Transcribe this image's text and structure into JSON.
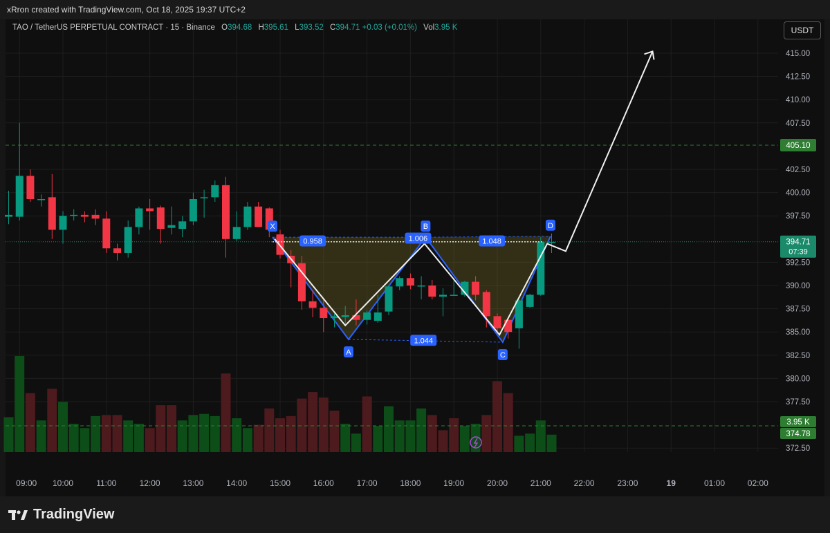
{
  "header": {
    "credit": "xRron created with TradingView.com, Oct 18, 2025 19:37 UTC+2"
  },
  "legend": {
    "symbol": "TAO / TetherUS PERPETUAL CONTRACT · 15 · Binance",
    "open_label": "O",
    "open": "394.68",
    "high_label": "H",
    "high": "395.61",
    "low_label": "L",
    "low": "393.52",
    "close_label": "C",
    "close": "394.71",
    "change": "+0.03 (+0.01%)",
    "vol_label": "Vol",
    "vol": "3.95 K"
  },
  "currency_button": "USDT",
  "brand": {
    "name": "TradingView"
  },
  "colors": {
    "up": "#089981",
    "down": "#f23645",
    "vol_up": "#0c4d18",
    "vol_down": "#4d1a1e",
    "pattern_line": "#2962ff",
    "background": "#0f0f0f"
  },
  "chart_data": {
    "type": "candlestick",
    "timeframe": "15",
    "ylim": [
      371.5,
      417.5
    ],
    "y_ticks": [
      "415.00",
      "412.50",
      "410.00",
      "407.50",
      "402.50",
      "400.00",
      "397.50",
      "392.50",
      "390.00",
      "387.50",
      "385.00",
      "382.50",
      "380.00",
      "377.50",
      "372.50"
    ],
    "x_ticks": [
      "09:00",
      "10:00",
      "11:00",
      "12:00",
      "13:00",
      "14:00",
      "15:00",
      "16:00",
      "17:00",
      "18:00",
      "19:00",
      "20:00",
      "21:00",
      "22:00",
      "23:00",
      "19",
      "01:00",
      "02:00"
    ],
    "candles": [
      {
        "o": 397.4,
        "h": 400.2,
        "l": 396.6,
        "c": 397.6
      },
      {
        "o": 397.4,
        "h": 407.5,
        "l": 397.0,
        "c": 401.8
      },
      {
        "o": 401.8,
        "h": 402.5,
        "l": 399.0,
        "c": 399.3
      },
      {
        "o": 399.3,
        "h": 399.8,
        "l": 398.5,
        "c": 399.3
      },
      {
        "o": 399.5,
        "h": 402.0,
        "l": 395.0,
        "c": 396.0
      },
      {
        "o": 396.0,
        "h": 398.0,
        "l": 394.5,
        "c": 397.5
      },
      {
        "o": 397.5,
        "h": 398.2,
        "l": 397.0,
        "c": 397.6
      },
      {
        "o": 397.6,
        "h": 398.0,
        "l": 396.8,
        "c": 397.4
      },
      {
        "o": 397.6,
        "h": 398.2,
        "l": 396.5,
        "c": 397.2
      },
      {
        "o": 397.2,
        "h": 398.0,
        "l": 393.5,
        "c": 394.0
      },
      {
        "o": 394.0,
        "h": 394.5,
        "l": 392.7,
        "c": 393.5
      },
      {
        "o": 393.5,
        "h": 397.0,
        "l": 393.0,
        "c": 396.3
      },
      {
        "o": 396.3,
        "h": 398.5,
        "l": 395.5,
        "c": 398.3
      },
      {
        "o": 398.3,
        "h": 399.3,
        "l": 396.0,
        "c": 398.0
      },
      {
        "o": 398.4,
        "h": 398.6,
        "l": 394.5,
        "c": 396.1
      },
      {
        "o": 396.2,
        "h": 398.5,
        "l": 395.5,
        "c": 396.5
      },
      {
        "o": 396.1,
        "h": 397.5,
        "l": 395.2,
        "c": 396.9
      },
      {
        "o": 396.9,
        "h": 400.0,
        "l": 396.5,
        "c": 399.3
      },
      {
        "o": 399.4,
        "h": 400.3,
        "l": 397.3,
        "c": 399.5
      },
      {
        "o": 399.5,
        "h": 401.3,
        "l": 399.0,
        "c": 400.8
      },
      {
        "o": 400.8,
        "h": 401.7,
        "l": 393.0,
        "c": 395.0
      },
      {
        "o": 395.0,
        "h": 398.0,
        "l": 394.8,
        "c": 396.3
      },
      {
        "o": 396.3,
        "h": 399.0,
        "l": 396.0,
        "c": 398.5
      },
      {
        "o": 398.5,
        "h": 399.0,
        "l": 396.3,
        "c": 396.3
      },
      {
        "o": 398.3,
        "h": 398.4,
        "l": 395.2,
        "c": 396.0
      },
      {
        "o": 395.5,
        "h": 396.0,
        "l": 392.9,
        "c": 393.3
      },
      {
        "o": 393.2,
        "h": 393.8,
        "l": 389.8,
        "c": 392.4
      },
      {
        "o": 392.4,
        "h": 393.2,
        "l": 387.4,
        "c": 388.3
      },
      {
        "o": 388.3,
        "h": 389.5,
        "l": 386.6,
        "c": 387.6
      },
      {
        "o": 387.6,
        "h": 388.5,
        "l": 385.0,
        "c": 386.5
      },
      {
        "o": 386.5,
        "h": 387.0,
        "l": 385.5,
        "c": 386.7
      },
      {
        "o": 386.6,
        "h": 387.8,
        "l": 385.7,
        "c": 386.8
      },
      {
        "o": 386.8,
        "h": 388.5,
        "l": 385.7,
        "c": 386.3
      },
      {
        "o": 386.3,
        "h": 387.3,
        "l": 385.8,
        "c": 387.1
      },
      {
        "o": 386.2,
        "h": 389.0,
        "l": 386.0,
        "c": 387.1
      },
      {
        "o": 387.2,
        "h": 390.0,
        "l": 386.8,
        "c": 389.9
      },
      {
        "o": 389.9,
        "h": 391.0,
        "l": 389.5,
        "c": 390.8
      },
      {
        "o": 390.8,
        "h": 391.3,
        "l": 389.6,
        "c": 390.0
      },
      {
        "o": 390.0,
        "h": 391.0,
        "l": 388.5,
        "c": 390.0
      },
      {
        "o": 390.0,
        "h": 390.6,
        "l": 388.5,
        "c": 388.8
      },
      {
        "o": 388.8,
        "h": 389.7,
        "l": 386.7,
        "c": 389.0
      },
      {
        "o": 389.0,
        "h": 390.6,
        "l": 388.9,
        "c": 389.0
      },
      {
        "o": 389.0,
        "h": 390.5,
        "l": 388.8,
        "c": 390.4
      },
      {
        "o": 390.4,
        "h": 391.0,
        "l": 388.4,
        "c": 389.0
      },
      {
        "o": 389.3,
        "h": 389.5,
        "l": 385.5,
        "c": 386.7
      },
      {
        "o": 386.7,
        "h": 387.0,
        "l": 385.0,
        "c": 385.4
      },
      {
        "o": 386.3,
        "h": 386.5,
        "l": 384.3,
        "c": 385.0
      },
      {
        "o": 385.4,
        "h": 388.5,
        "l": 383.2,
        "c": 388.4
      },
      {
        "o": 387.7,
        "h": 389.1,
        "l": 387.6,
        "c": 389.0
      },
      {
        "o": 389.0,
        "h": 395.2,
        "l": 388.9,
        "c": 394.7
      },
      {
        "o": 394.7,
        "h": 395.6,
        "l": 393.5,
        "c": 394.7
      }
    ],
    "volume_max": 100,
    "volume": [
      32,
      88,
      54,
      29,
      58,
      46,
      26,
      22,
      33,
      34,
      34,
      29,
      26,
      22,
      43,
      43,
      29,
      34,
      35,
      33,
      72,
      31,
      22,
      25,
      40,
      31,
      33,
      49,
      55,
      50,
      38,
      26,
      17,
      51,
      24,
      42,
      29,
      29,
      40,
      34,
      20,
      31,
      24,
      26,
      34,
      65,
      54,
      15,
      17,
      29,
      16
    ],
    "volume_up_flags": [
      1,
      1,
      0,
      1,
      0,
      1,
      1,
      1,
      1,
      0,
      0,
      1,
      1,
      0,
      0,
      0,
      1,
      1,
      1,
      1,
      0,
      1,
      1,
      0,
      0,
      0,
      0,
      0,
      0,
      0,
      0,
      1,
      1,
      0,
      1,
      1,
      1,
      1,
      1,
      0,
      0,
      0,
      1,
      1,
      0,
      0,
      0,
      1,
      1,
      1,
      1
    ],
    "price_lines": [
      {
        "value": 405.1,
        "label": "405.10",
        "style": "dashed"
      },
      {
        "value": 394.71,
        "label": "394.71",
        "style": "dotted"
      }
    ],
    "last_price_badge": {
      "price": "394.71",
      "countdown": "07:39"
    },
    "volume_line": {
      "label": "3.95 K",
      "value": "374.78"
    },
    "harmonic_pattern": {
      "points": [
        {
          "label": "X",
          "i": 24.3,
          "y": 395.2
        },
        {
          "label": "A",
          "i": 31.3,
          "y": 384.2
        },
        {
          "label": "B",
          "i": 38.4,
          "y": 395.2
        },
        {
          "label": "C",
          "i": 45.5,
          "y": 383.9
        },
        {
          "label": "D",
          "i": 49.9,
          "y": 395.3
        }
      ],
      "ratios": [
        {
          "label": "0.958",
          "i": 28.0,
          "y": 394.8
        },
        {
          "label": "1.006",
          "i": 37.7,
          "y": 395.1
        },
        {
          "label": "1.048",
          "i": 44.5,
          "y": 394.8
        },
        {
          "label": "1.044",
          "i": 38.2,
          "y": 384.1
        }
      ]
    },
    "projection_path": [
      {
        "i": 24.5,
        "y": 395.0
      },
      {
        "i": 31.0,
        "y": 385.7
      },
      {
        "i": 38.3,
        "y": 394.5
      },
      {
        "i": 45.2,
        "y": 384.7
      },
      {
        "i": 49.6,
        "y": 394.5
      },
      {
        "i": 51.3,
        "y": 393.7
      },
      {
        "i": 59.3,
        "y": 415.2
      }
    ],
    "x_time_start": "08:45",
    "minutes_per_bar": 15
  }
}
